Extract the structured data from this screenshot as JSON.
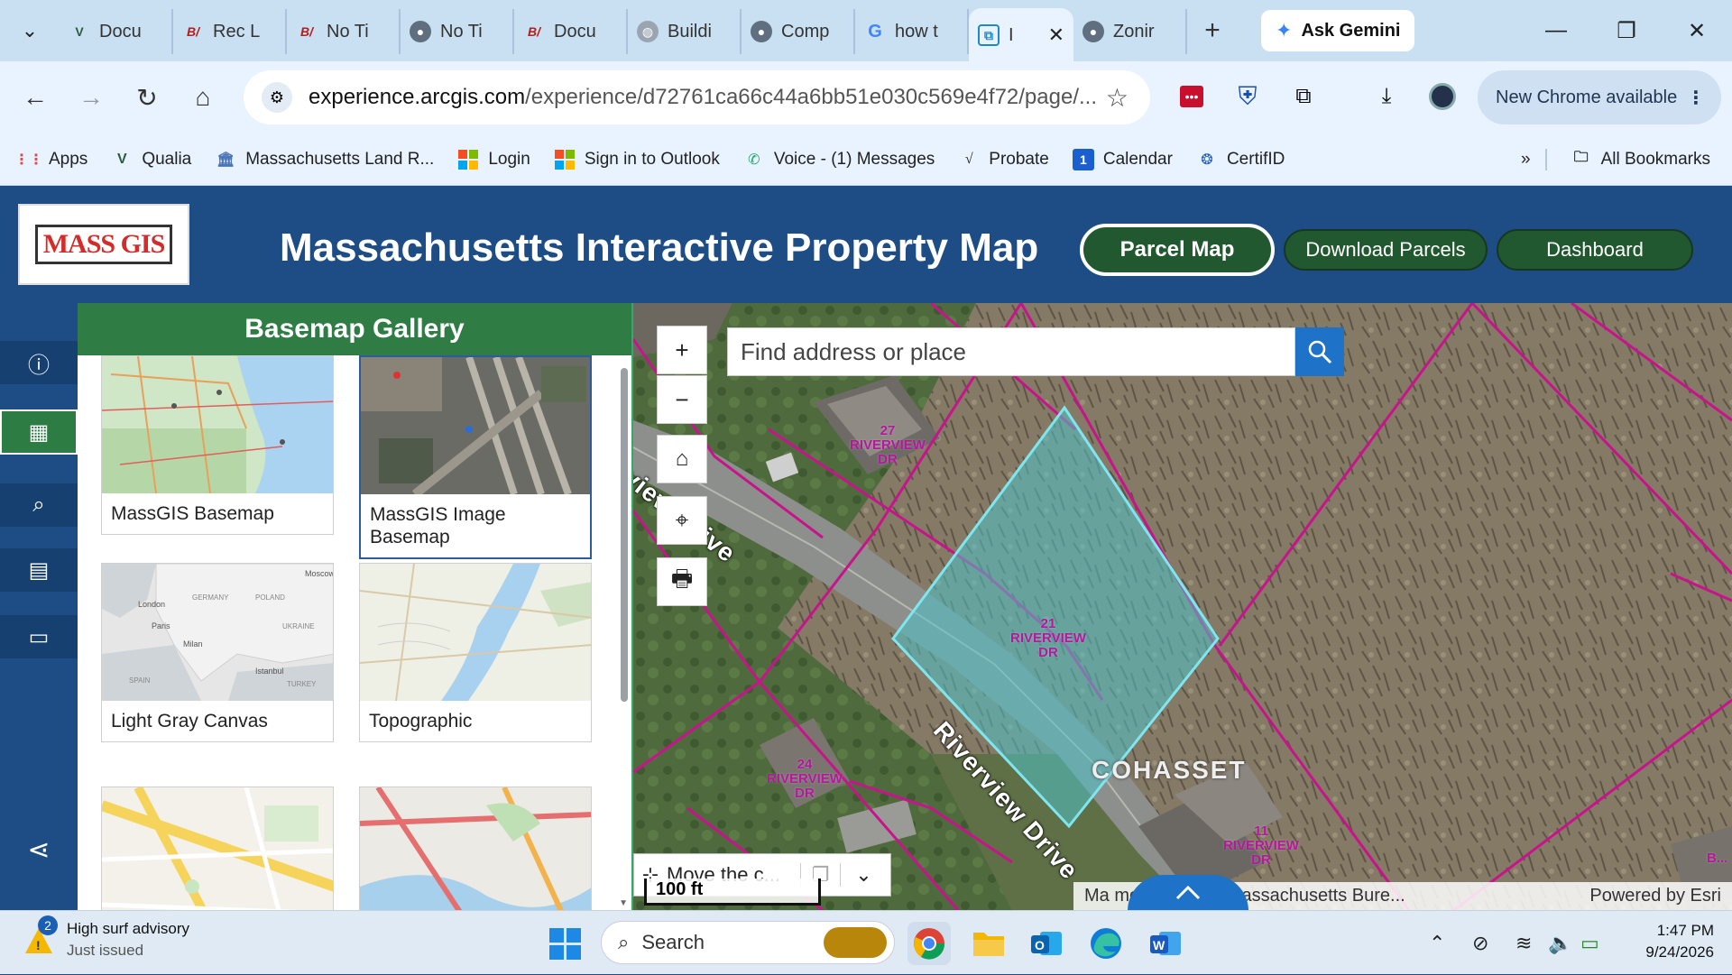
{
  "browser": {
    "tabs": [
      {
        "label": "Docu",
        "icon": "qualia-icon",
        "active": false
      },
      {
        "label": "Rec L",
        "icon": "bt-icon",
        "active": false
      },
      {
        "label": "No Ti",
        "icon": "bt-icon",
        "active": false
      },
      {
        "label": "No Ti",
        "icon": "globe-icon",
        "active": false
      },
      {
        "label": "Docu",
        "icon": "bt-icon",
        "active": false
      },
      {
        "label": "Buildi",
        "icon": "globe-icon",
        "active": false
      },
      {
        "label": "Comp",
        "icon": "globe-icon",
        "active": false
      },
      {
        "label": "how t",
        "icon": "google-icon",
        "active": false
      },
      {
        "label": "I",
        "icon": "arcgis-icon",
        "active": true
      },
      {
        "label": "Zonir",
        "icon": "globe-icon",
        "active": false
      }
    ],
    "new_tab": "+",
    "gemini_label": "Ask Gemini",
    "url_host": "experience.arcgis.com",
    "url_path": "/experience/d72761ca66c44a6bb51e030c569e4f72/page/...",
    "new_chrome_label": "New Chrome available",
    "bookmarks": [
      {
        "label": "Apps",
        "icon": "apps-grid-icon"
      },
      {
        "label": "Qualia",
        "icon": "qualia-icon"
      },
      {
        "label": "Massachusetts Land R...",
        "icon": "building-icon"
      },
      {
        "label": "Login",
        "icon": "windows-icon"
      },
      {
        "label": "Sign in to Outlook",
        "icon": "windows-icon"
      },
      {
        "label": "Voice - (1) Messages",
        "icon": "phone-icon"
      },
      {
        "label": "Probate",
        "icon": "probate-icon"
      },
      {
        "label": "Calendar",
        "icon": "calendar-icon"
      },
      {
        "label": "CertifID",
        "icon": "certifid-icon"
      }
    ],
    "all_bookmarks": "All Bookmarks"
  },
  "app": {
    "logo_text": "MASS GIS",
    "title": "Massachusetts Interactive Property Map",
    "nav": {
      "parcel_map": "Parcel Map",
      "download_parcels": "Download Parcels",
      "dashboard": "Dashboard"
    }
  },
  "panel": {
    "title": "Basemap Gallery",
    "basemaps": [
      {
        "label": "MassGIS Basemap",
        "selected": false
      },
      {
        "label": "MassGIS Image Basemap",
        "selected": true
      },
      {
        "label": "Light Gray Canvas",
        "selected": false
      },
      {
        "label": "Topographic",
        "selected": false
      },
      {
        "label": "",
        "selected": false
      },
      {
        "label": "",
        "selected": false
      }
    ],
    "thumb_text": {
      "light_gray": [
        "London",
        "Paris",
        "Milan",
        "Istanbul",
        "Moscow",
        "POLAND",
        "UKRAINE",
        "GERMANY",
        "SPAIN",
        "TURKEY"
      ]
    }
  },
  "map": {
    "search_placeholder": "Find address or place",
    "zoom_in": "+",
    "zoom_out": "−",
    "move_label": "Move the c...",
    "scale_label": "100 ft",
    "attribution": "Ma      monwealth of Massachusetts Bure...",
    "powered_by": "Powered by Esri",
    "town_label": "COHASSET",
    "road_label": "Riverview Drive",
    "road_label_partial": "erview Drive",
    "parcels": [
      {
        "label": "27 RIVERVIEW DR"
      },
      {
        "label": "21 RIVERVIEW DR"
      },
      {
        "label": "24 RIVERVIEW DR"
      },
      {
        "label": "11 RIVERVIEW DR"
      }
    ],
    "edge_label": "B..."
  },
  "taskbar": {
    "weather_badge": "2",
    "weather_title": "High surf advisory",
    "weather_sub": "Just issued",
    "search_label": "Search",
    "time": "1:47 PM",
    "date": "9/24/2026"
  },
  "colors": {
    "header_blue": "#1e4d86",
    "green": "#2f7d45",
    "parcel_line": "#c8148c",
    "selected_parcel": "#4fc3c8",
    "esri_blue": "#1e73c8"
  }
}
